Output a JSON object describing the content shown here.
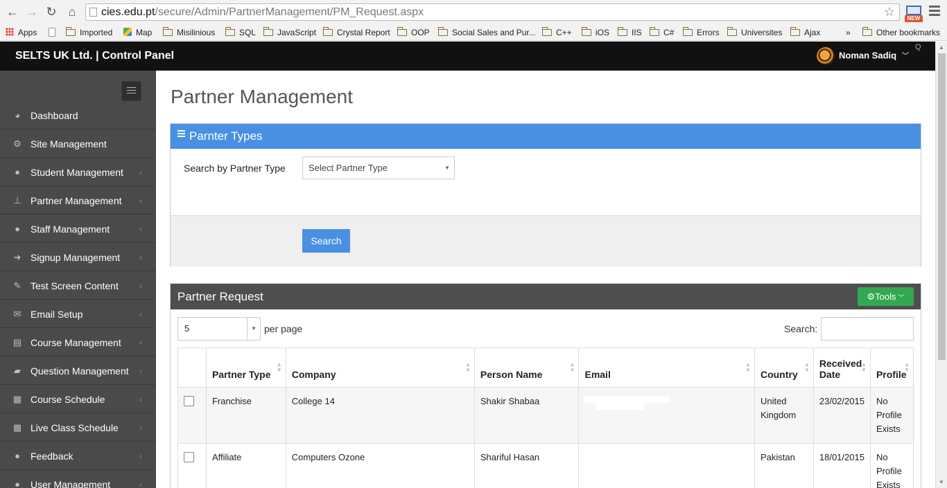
{
  "browser": {
    "url_host": "cies.edu.pt",
    "url_path": "/secure/Admin/PartnerManagement/PM_Request.aspx",
    "ext_badge": "NEW"
  },
  "bookmarks": {
    "items": [
      "Apps",
      "Imported",
      "Map",
      "Misilinious",
      "SQL",
      "JavaScript",
      "Crystal Report",
      "OOP",
      "Social Sales and Pur...",
      "C++",
      "iOS",
      "IIS",
      "C#",
      "Errors",
      "Universites",
      "Ajax"
    ],
    "overflow": "»",
    "other": "Other bookmarks"
  },
  "header": {
    "brand": "SELTS UK Ltd. | Control Panel",
    "user_name": "Noman Sadiq",
    "corner_mark": "Q"
  },
  "sidebar": {
    "items": [
      {
        "label": "Dashboard",
        "icon": "dashboard-icon",
        "glyph": "◕",
        "arrow": ""
      },
      {
        "label": "Site Management",
        "icon": "cogs-icon",
        "glyph": "⚙",
        "arrow": ""
      },
      {
        "label": "Student Management",
        "icon": "user-icon",
        "glyph": "●",
        "arrow": "‹"
      },
      {
        "label": "Partner Management",
        "icon": "sitemap-icon",
        "glyph": "⊥",
        "arrow": "‹"
      },
      {
        "label": "Staff Management",
        "icon": "users-icon",
        "glyph": "●",
        "arrow": "‹"
      },
      {
        "label": "Signup Management",
        "icon": "sign-in-icon",
        "glyph": "➜",
        "arrow": "‹"
      },
      {
        "label": "Test Screen Content",
        "icon": "edit-icon",
        "glyph": "✎",
        "arrow": "‹"
      },
      {
        "label": "Email Setup",
        "icon": "envelope-icon",
        "glyph": "✉",
        "arrow": "‹"
      },
      {
        "label": "Course Management",
        "icon": "book-icon",
        "glyph": "▤",
        "arrow": "‹"
      },
      {
        "label": "Question Management",
        "icon": "folder-open-icon",
        "glyph": "▰",
        "arrow": "‹"
      },
      {
        "label": "Course Schedule",
        "icon": "calendar-icon",
        "glyph": "▦",
        "arrow": "‹"
      },
      {
        "label": "Live Class Schedule",
        "icon": "calendar-icon",
        "glyph": "▦",
        "arrow": "‹"
      },
      {
        "label": "Feedback",
        "icon": "comments-icon",
        "glyph": "●",
        "arrow": "‹"
      },
      {
        "label": "User Management",
        "icon": "user-icon",
        "glyph": "●",
        "arrow": "‹"
      }
    ]
  },
  "main": {
    "title": "Partner Management",
    "types_panel": {
      "title": "Parnter Types",
      "search_label": "Search by Partner Type",
      "select_value": "Select Partner Type",
      "search_button": "Search"
    },
    "request_panel": {
      "title": "Partner Request",
      "tools_label": "Tools",
      "per_page_value": "5",
      "per_page_label": "per page",
      "search_label": "Search:",
      "columns": [
        "",
        "Partner Type",
        "Company",
        "Person Name",
        "Email",
        "Country",
        "Received Date",
        "Profile"
      ],
      "rows": [
        {
          "partner_type": "Franchise",
          "company": "College 14",
          "person": "Shakir Shabaa",
          "email": "",
          "country": "United Kingdom",
          "date": "23/02/2015",
          "profile": "No Profile Exists"
        },
        {
          "partner_type": "Affiliate",
          "company": "Computers Ozone",
          "person": "Shariful Hasan",
          "email": "",
          "country": "Pakistan",
          "date": "18/01/2015",
          "profile": "No Profile Exists"
        }
      ]
    }
  },
  "colors": {
    "accent_blue": "#4a90e2",
    "tools_green": "#33a852",
    "sidebar_bg": "#4a4a4a",
    "header_bg": "#111111"
  }
}
